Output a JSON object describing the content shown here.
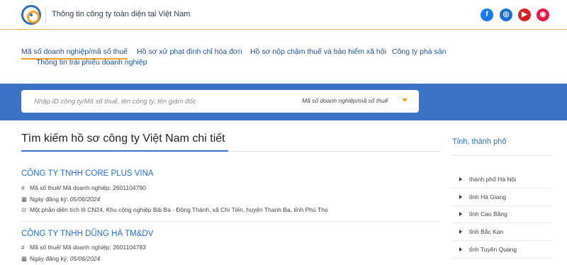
{
  "header": {
    "site_title": "Thông tin công ty toàn diện tại Việt Nam",
    "social": [
      {
        "name": "facebook-icon",
        "glyph": "f",
        "color": "#1877f2"
      },
      {
        "name": "instagram-icon",
        "glyph": "◎",
        "color": "#1f6fd1"
      },
      {
        "name": "youtube-icon",
        "glyph": "▶",
        "color": "#e02020"
      },
      {
        "name": "pinterest-icon",
        "glyph": "◉",
        "color": "#e8174a"
      }
    ]
  },
  "nav": {
    "items": [
      "Mã số doanh nghiệp/mã số thuế",
      "Hồ sơ xử phạt đình chỉ hóa đơn",
      "Hồ sơ nộp chậm thuế và bảo hiểm xã hội",
      "Công ty phá sản",
      "Thông tin trái phiếu doanh nghiệp"
    ],
    "active_index": 0
  },
  "search": {
    "placeholder": "Nhập ID công ty/Mã số thuế, tên công ty, tên giám đốc",
    "select_value": "Mã số doanh nghiệp/mã số thuế"
  },
  "main": {
    "title": "Tìm kiếm hồ sơ công ty Việt Nam chi tiết",
    "companies": [
      {
        "name": "CÔNG TY TNHH CORE PLUS VINA",
        "tax_label": "Mã số thuế/ Mã doanh nghiệp: 2601104790",
        "date_label": "Ngày đăng ký: ",
        "date_value": "05/06/2024",
        "address": "Một phần diện tích lô CN24, Khu công nghiệp Bãi Ba - Đông Thành, xã Chí Tiến, huyện Thanh Ba, tỉnh Phú Thọ"
      },
      {
        "name": "CÔNG TY TNHH DŨNG HÀ TM&DV",
        "tax_label": "Mã số thuế/ Mã doanh nghiệp: 2601104783",
        "date_label": "Ngày đăng ký: ",
        "date_value": "05/06/2024"
      }
    ]
  },
  "sidebar": {
    "title": "Tỉnh, thành phố",
    "items": [
      "thành phố Hà Nội",
      "tỉnh Hà Giang",
      "tỉnh Cao Bằng",
      "tỉnh Bắc Kạn",
      "tỉnh Tuyên Quang"
    ]
  },
  "colors": {
    "accent": "#f4a322",
    "brand_blue": "#3a72c6",
    "link_blue": "#1f6fd1"
  }
}
